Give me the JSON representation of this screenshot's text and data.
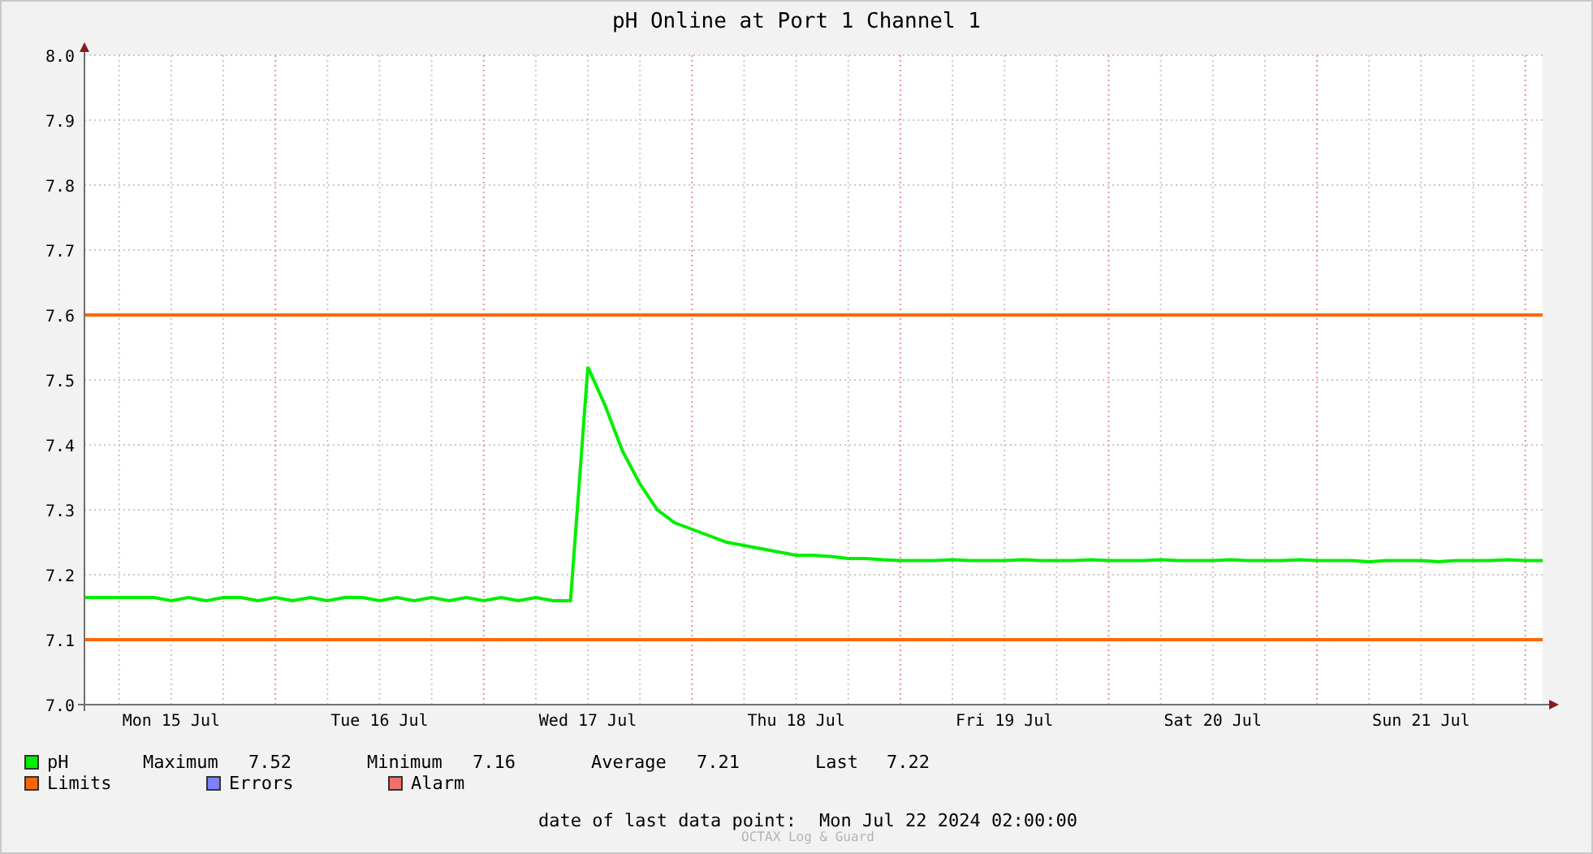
{
  "title": "pH Online at Port 1 Channel 1",
  "chart_data": {
    "type": "line",
    "categories": [
      null,
      null,
      null,
      null,
      null,
      "Mon 15 Jul",
      null,
      null,
      null,
      null,
      null,
      null,
      null,
      null,
      null,
      null,
      null,
      "Tue 16 Jul",
      null,
      null,
      null,
      null,
      null,
      null,
      null,
      null,
      null,
      null,
      null,
      "Wed 17 Jul",
      null,
      null,
      null,
      null,
      null,
      null,
      null,
      null,
      null,
      null,
      null,
      "Thu 18 Jul",
      null,
      null,
      null,
      null,
      null,
      null,
      null,
      null,
      null,
      null,
      null,
      "Fri 19 Jul",
      null,
      null,
      null,
      null,
      null,
      null,
      null,
      null,
      null,
      null,
      null,
      "Sat 20 Jul",
      null,
      null,
      null,
      null,
      null,
      null,
      null,
      null,
      null,
      null,
      null,
      "Sun 21 Jul",
      null,
      null,
      null,
      null,
      null,
      null,
      null
    ],
    "series": [
      {
        "name": "pH",
        "color": "#00ee00",
        "values": [
          7.165,
          7.165,
          7.165,
          7.165,
          7.165,
          7.16,
          7.165,
          7.16,
          7.165,
          7.165,
          7.16,
          7.165,
          7.16,
          7.165,
          7.16,
          7.165,
          7.165,
          7.16,
          7.165,
          7.16,
          7.165,
          7.16,
          7.165,
          7.16,
          7.165,
          7.16,
          7.165,
          7.16,
          7.16,
          7.52,
          7.46,
          7.39,
          7.34,
          7.3,
          7.28,
          7.27,
          7.26,
          7.25,
          7.245,
          7.24,
          7.235,
          7.23,
          7.23,
          7.228,
          7.225,
          7.225,
          7.223,
          7.222,
          7.222,
          7.222,
          7.223,
          7.222,
          7.222,
          7.222,
          7.223,
          7.222,
          7.222,
          7.222,
          7.223,
          7.222,
          7.222,
          7.222,
          7.223,
          7.222,
          7.222,
          7.222,
          7.223,
          7.222,
          7.222,
          7.222,
          7.223,
          7.222,
          7.222,
          7.222,
          7.22,
          7.222,
          7.222,
          7.222,
          7.22,
          7.222,
          7.222,
          7.222,
          7.223,
          7.222,
          7.222
        ]
      },
      {
        "name": "Limits",
        "color": "#ff6600",
        "values": [
          7.6,
          7.6,
          7.6,
          7.6,
          7.6,
          7.6,
          7.6,
          7.6,
          7.6,
          7.6,
          7.6,
          7.6,
          7.6,
          7.6,
          7.6,
          7.6,
          7.6,
          7.6,
          7.6,
          7.6,
          7.6,
          7.6,
          7.6,
          7.6,
          7.6,
          7.6,
          7.6,
          7.6,
          7.6,
          7.6,
          7.6,
          7.6,
          7.6,
          7.6,
          7.6,
          7.6,
          7.6,
          7.6,
          7.6,
          7.6,
          7.6,
          7.6,
          7.6,
          7.6,
          7.6,
          7.6,
          7.6,
          7.6,
          7.6,
          7.6,
          7.6,
          7.6,
          7.6,
          7.6,
          7.6,
          7.6,
          7.6,
          7.6,
          7.6,
          7.6,
          7.6,
          7.6,
          7.6,
          7.6,
          7.6,
          7.6,
          7.6,
          7.6,
          7.6,
          7.6,
          7.6,
          7.6,
          7.6,
          7.6,
          7.6,
          7.6,
          7.6,
          7.6,
          7.6,
          7.6,
          7.6,
          7.6,
          7.6,
          7.6,
          7.6
        ]
      },
      {
        "color": "#ff6600",
        "values": [
          7.1,
          7.1,
          7.1,
          7.1,
          7.1,
          7.1,
          7.1,
          7.1,
          7.1,
          7.1,
          7.1,
          7.1,
          7.1,
          7.1,
          7.1,
          7.1,
          7.1,
          7.1,
          7.1,
          7.1,
          7.1,
          7.1,
          7.1,
          7.1,
          7.1,
          7.1,
          7.1,
          7.1,
          7.1,
          7.1,
          7.1,
          7.1,
          7.1,
          7.1,
          7.1,
          7.1,
          7.1,
          7.1,
          7.1,
          7.1,
          7.1,
          7.1,
          7.1,
          7.1,
          7.1,
          7.1,
          7.1,
          7.1,
          7.1,
          7.1,
          7.1,
          7.1,
          7.1,
          7.1,
          7.1,
          7.1,
          7.1,
          7.1,
          7.1,
          7.1,
          7.1,
          7.1,
          7.1,
          7.1,
          7.1,
          7.1,
          7.1,
          7.1,
          7.1,
          7.1,
          7.1,
          7.1,
          7.1,
          7.1,
          7.1,
          7.1,
          7.1,
          7.1,
          7.1,
          7.1,
          7.1,
          7.1,
          7.1,
          7.1,
          7.1
        ]
      }
    ],
    "ylim": [
      7.0,
      8.0
    ],
    "yticks": [
      {
        "value": 7.0,
        "label": "7.0"
      },
      7.1,
      7.2,
      7.3,
      7.4,
      7.5,
      7.6,
      7.7,
      7.8,
      7.9,
      {
        "value": 8.0,
        "label": "8.0"
      }
    ],
    "grid": true
  },
  "legend": [
    {
      "label": "Errors",
      "color": "#7f7fff"
    },
    {
      "label": "Alarm",
      "color": "#f07070"
    }
  ],
  "stats": [
    {
      "label": "Maximum",
      "value": "7.52"
    },
    {
      "label": "Minimum",
      "value": "7.16"
    },
    {
      "label": "Average",
      "value": "7.21"
    },
    {
      "label": "Last",
      "value": "7.22"
    }
  ],
  "last_data": {
    "label": "date of last data point:",
    "value": "Mon Jul 22 2024 02:00:00"
  },
  "watermark": "OCTAX Log & Guard"
}
